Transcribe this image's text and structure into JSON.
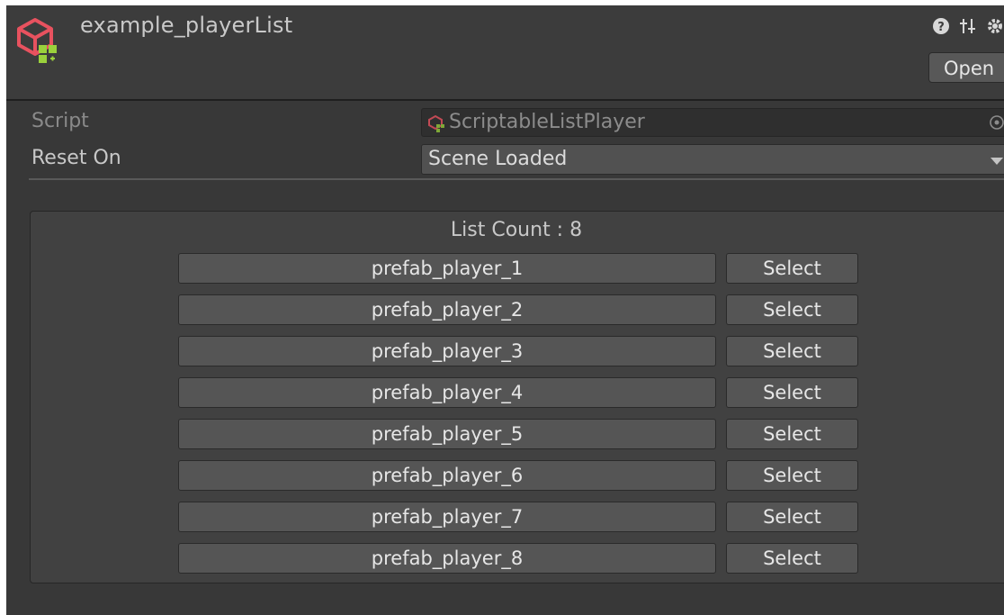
{
  "header": {
    "title": "example_playerList",
    "open_label": "Open"
  },
  "fields": {
    "script": {
      "label": "Script",
      "value": "ScriptableListPlayer"
    },
    "reset_on": {
      "label": "Reset On",
      "value": "Scene Loaded"
    }
  },
  "list": {
    "count_text": "List Count : 8",
    "select_label": "Select",
    "items": [
      {
        "name": "prefab_player_1"
      },
      {
        "name": "prefab_player_2"
      },
      {
        "name": "prefab_player_3"
      },
      {
        "name": "prefab_player_4"
      },
      {
        "name": "prefab_player_5"
      },
      {
        "name": "prefab_player_6"
      },
      {
        "name": "prefab_player_7"
      },
      {
        "name": "prefab_player_8"
      }
    ]
  },
  "icons": {
    "asset": "scriptable-object-icon",
    "help": "help-icon",
    "presets": "presets-icon",
    "settings": "gear-icon",
    "target": "object-picker-icon",
    "dropdown": "chevron-down-icon"
  },
  "colors": {
    "brand_red": "#e8525f",
    "brand_green": "#9ad13c",
    "panel": "#383838"
  }
}
